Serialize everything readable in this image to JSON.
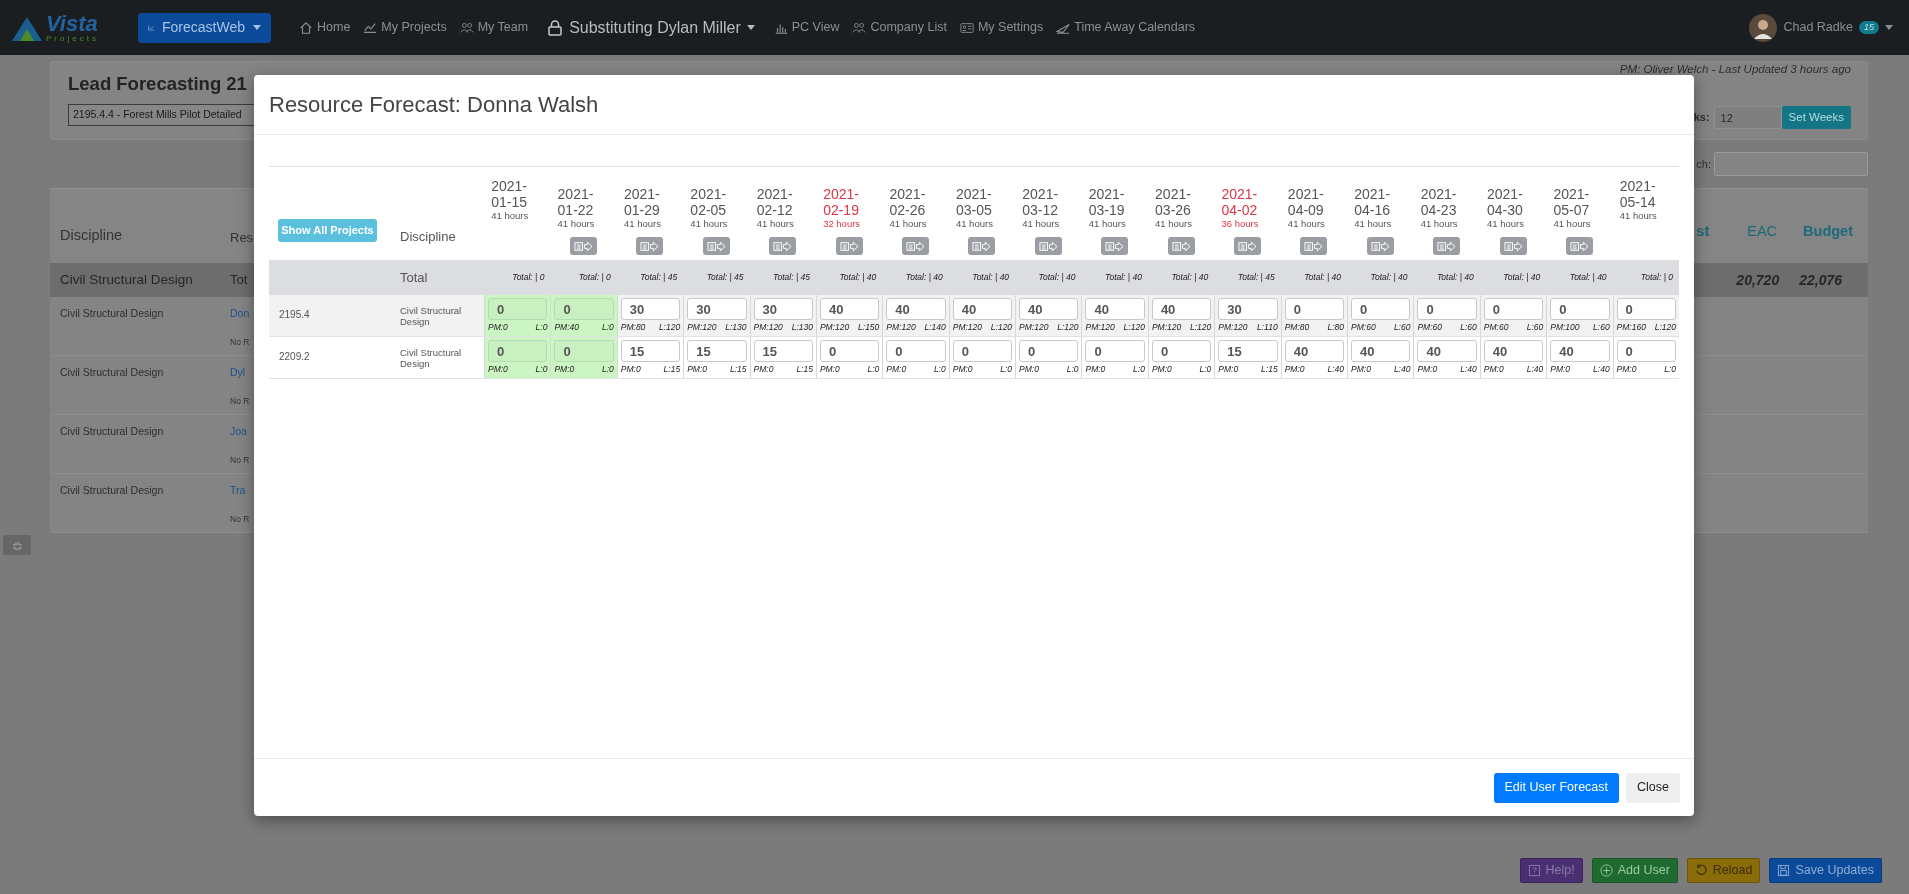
{
  "navbar": {
    "logo": {
      "name": "Vista",
      "tagline": "Projects"
    },
    "app_menu": "ForecastWeb",
    "links": [
      {
        "label": "Home",
        "kind": "link"
      },
      {
        "label": "My Projects",
        "kind": "link"
      },
      {
        "label": "My Team",
        "kind": "link"
      },
      {
        "label": "Substituting Dylan Miller",
        "kind": "menu"
      },
      {
        "label": "PC View",
        "kind": "link"
      },
      {
        "label": "Company List",
        "kind": "link"
      },
      {
        "label": "My Settings",
        "kind": "link"
      },
      {
        "label": "Time Away Calendars",
        "kind": "link"
      }
    ],
    "user": {
      "name": "Chad Radke",
      "badge": "15"
    }
  },
  "page": {
    "title": "Lead Forecasting 21",
    "project_select": "2195.4.4 - Forest Mills Pilot Detailed",
    "pm_note": "PM: Oliver Welch - Last Updated 3 hours ago",
    "weeks_label": "ks:",
    "weeks_value": "12",
    "set_weeks": "Set Weeks",
    "search_label": "ch:",
    "columns": [
      "Discipline",
      "Res",
      "st",
      "EAC",
      "Budget"
    ],
    "total_row": {
      "discipline": "Civil Structural Design",
      "resource": "Tot",
      "eac": "20,720",
      "budget": "22,076"
    },
    "rows": [
      {
        "discipline": "Civil Structural Design",
        "resource": "Don",
        "note": "No R"
      },
      {
        "discipline": "Civil Structural Design",
        "resource": "Dyl",
        "note": "No R"
      },
      {
        "discipline": "Civil Structural Design",
        "resource": "Joa",
        "note": "No R"
      },
      {
        "discipline": "Civil Structural Design",
        "resource": "Tra",
        "note": "No R"
      }
    ]
  },
  "modal": {
    "title": "Resource Forecast: Donna Walsh",
    "show_all": "Show All Projects",
    "discipline_header": "Discipline",
    "total_label": "Total",
    "weeks": [
      {
        "date": "2021-01-15",
        "hours": "41 hours",
        "warning": false,
        "action": false
      },
      {
        "date": "2021-01-22",
        "hours": "41 hours",
        "warning": false,
        "action": true
      },
      {
        "date": "2021-01-29",
        "hours": "41 hours",
        "warning": false,
        "action": true
      },
      {
        "date": "2021-02-05",
        "hours": "41 hours",
        "warning": false,
        "action": true
      },
      {
        "date": "2021-02-12",
        "hours": "41 hours",
        "warning": false,
        "action": true
      },
      {
        "date": "2021-02-19",
        "hours": "32 hours",
        "warning": true,
        "action": true
      },
      {
        "date": "2021-02-26",
        "hours": "41 hours",
        "warning": false,
        "action": true
      },
      {
        "date": "2021-03-05",
        "hours": "41 hours",
        "warning": false,
        "action": true
      },
      {
        "date": "2021-03-12",
        "hours": "41 hours",
        "warning": false,
        "action": true
      },
      {
        "date": "2021-03-19",
        "hours": "41 hours",
        "warning": false,
        "action": true
      },
      {
        "date": "2021-03-26",
        "hours": "41 hours",
        "warning": false,
        "action": true
      },
      {
        "date": "2021-04-02",
        "hours": "36 hours",
        "warning": true,
        "action": true
      },
      {
        "date": "2021-04-09",
        "hours": "41 hours",
        "warning": false,
        "action": true
      },
      {
        "date": "2021-04-16",
        "hours": "41 hours",
        "warning": false,
        "action": true
      },
      {
        "date": "2021-04-23",
        "hours": "41 hours",
        "warning": false,
        "action": true
      },
      {
        "date": "2021-04-30",
        "hours": "41 hours",
        "warning": false,
        "action": true
      },
      {
        "date": "2021-05-07",
        "hours": "41 hours",
        "warning": false,
        "action": true
      },
      {
        "date": "2021-05-14",
        "hours": "41 hours",
        "warning": false,
        "action": false
      }
    ],
    "totals": [
      "Total: | 0",
      "Total: | 0",
      "Total: | 45",
      "Total: | 45",
      "Total: | 45",
      "Total: | 40",
      "Total: | 40",
      "Total: | 40",
      "Total: | 40",
      "Total: | 40",
      "Total: | 40",
      "Total: | 45",
      "Total: | 40",
      "Total: | 40",
      "Total: | 40",
      "Total: | 40",
      "Total: | 40",
      "Total: | 0"
    ],
    "rows": [
      {
        "project": "2195.4",
        "discipline": "Civil Structural Design",
        "cells": [
          {
            "value": "0",
            "pm": "PM:0",
            "l": "L:0",
            "locked": true
          },
          {
            "value": "0",
            "pm": "PM:40",
            "l": "L:0",
            "locked": true
          },
          {
            "value": "30",
            "pm": "PM:80",
            "l": "L:120",
            "locked": false
          },
          {
            "value": "30",
            "pm": "PM:120",
            "l": "L:130",
            "locked": false
          },
          {
            "value": "30",
            "pm": "PM:120",
            "l": "L:130",
            "locked": false
          },
          {
            "value": "40",
            "pm": "PM:120",
            "l": "L:150",
            "locked": false
          },
          {
            "value": "40",
            "pm": "PM:120",
            "l": "L:140",
            "locked": false
          },
          {
            "value": "40",
            "pm": "PM:120",
            "l": "L:120",
            "locked": false
          },
          {
            "value": "40",
            "pm": "PM:120",
            "l": "L:120",
            "locked": false
          },
          {
            "value": "40",
            "pm": "PM:120",
            "l": "L:120",
            "locked": false
          },
          {
            "value": "40",
            "pm": "PM:120",
            "l": "L:120",
            "locked": false
          },
          {
            "value": "30",
            "pm": "PM:120",
            "l": "L:110",
            "locked": false
          },
          {
            "value": "0",
            "pm": "PM:80",
            "l": "L:80",
            "locked": false
          },
          {
            "value": "0",
            "pm": "PM:60",
            "l": "L:60",
            "locked": false
          },
          {
            "value": "0",
            "pm": "PM:60",
            "l": "L:60",
            "locked": false
          },
          {
            "value": "0",
            "pm": "PM:60",
            "l": "L:60",
            "locked": false
          },
          {
            "value": "0",
            "pm": "PM:100",
            "l": "L:60",
            "locked": false
          },
          {
            "value": "0",
            "pm": "PM:160",
            "l": "L:120",
            "locked": false
          }
        ]
      },
      {
        "project": "2209.2",
        "discipline": "Civil Structural Design",
        "cells": [
          {
            "value": "0",
            "pm": "PM:0",
            "l": "L:0",
            "locked": true
          },
          {
            "value": "0",
            "pm": "PM:0",
            "l": "L:0",
            "locked": true
          },
          {
            "value": "15",
            "pm": "PM:0",
            "l": "L:15",
            "locked": false
          },
          {
            "value": "15",
            "pm": "PM:0",
            "l": "L:15",
            "locked": false
          },
          {
            "value": "15",
            "pm": "PM:0",
            "l": "L:15",
            "locked": false
          },
          {
            "value": "0",
            "pm": "PM:0",
            "l": "L:0",
            "locked": false
          },
          {
            "value": "0",
            "pm": "PM:0",
            "l": "L:0",
            "locked": false
          },
          {
            "value": "0",
            "pm": "PM:0",
            "l": "L:0",
            "locked": false
          },
          {
            "value": "0",
            "pm": "PM:0",
            "l": "L:0",
            "locked": false
          },
          {
            "value": "0",
            "pm": "PM:0",
            "l": "L:0",
            "locked": false
          },
          {
            "value": "0",
            "pm": "PM:0",
            "l": "L:0",
            "locked": false
          },
          {
            "value": "15",
            "pm": "PM:0",
            "l": "L:15",
            "locked": false
          },
          {
            "value": "40",
            "pm": "PM:0",
            "l": "L:40",
            "locked": false
          },
          {
            "value": "40",
            "pm": "PM:0",
            "l": "L:40",
            "locked": false
          },
          {
            "value": "40",
            "pm": "PM:0",
            "l": "L:40",
            "locked": false
          },
          {
            "value": "40",
            "pm": "PM:0",
            "l": "L:40",
            "locked": false
          },
          {
            "value": "40",
            "pm": "PM:0",
            "l": "L:40",
            "locked": false
          },
          {
            "value": "0",
            "pm": "PM:0",
            "l": "L:0",
            "locked": false
          }
        ]
      }
    ],
    "buttons": [
      {
        "label": "Edit User Forecast",
        "kind": "primary"
      },
      {
        "label": "Close",
        "kind": "secondary"
      }
    ]
  },
  "action_buttons": [
    {
      "label": "Help!",
      "color": "#4a2f72"
    },
    {
      "label": "Add User",
      "color": "#1e6a2f"
    },
    {
      "label": "Reload",
      "color": "#8a6c0a"
    },
    {
      "label": "Save Updates",
      "color": "#0a4a98"
    }
  ]
}
